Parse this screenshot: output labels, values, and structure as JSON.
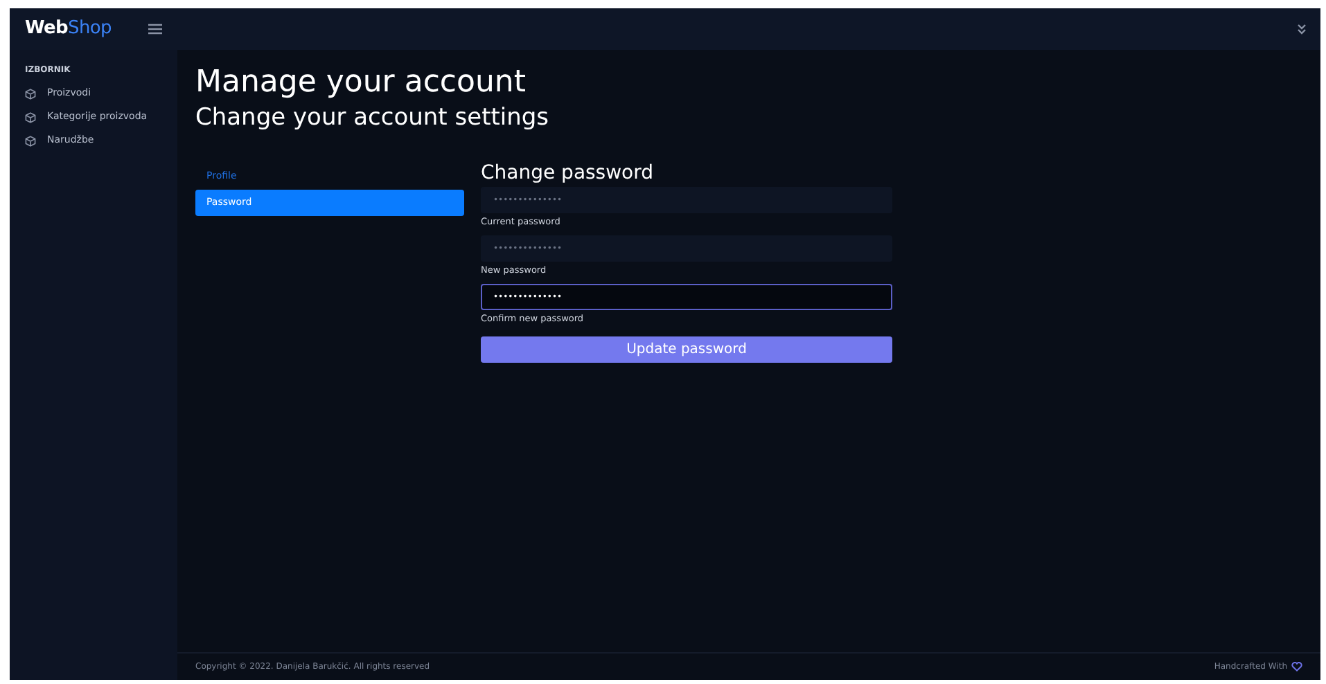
{
  "brand": {
    "bold": "Web",
    "light": "Shop"
  },
  "sidebar": {
    "heading": "IZBORNIK",
    "items": [
      {
        "label": "Proizvodi"
      },
      {
        "label": "Kategorije proizvoda"
      },
      {
        "label": "Narudžbe"
      }
    ]
  },
  "page": {
    "title": "Manage your account",
    "subtitle": "Change your account settings"
  },
  "tabs": [
    {
      "label": "Profile",
      "selected": false
    },
    {
      "label": "Password",
      "selected": true
    }
  ],
  "form": {
    "title": "Change password",
    "fields": [
      {
        "caption_below": "Current password",
        "placeholder": "••••••••••••••",
        "focused": false
      },
      {
        "caption_below": "New password",
        "placeholder": "••••••••••••••",
        "focused": false
      },
      {
        "caption_below": "Confirm new password",
        "value": "••••••••••••••",
        "focused": true
      }
    ],
    "button": "Update password"
  },
  "footer": {
    "copyright": "Copyright © 2022. Danijela Barukčić. All rights reserved",
    "credit": "Handcrafted With"
  }
}
